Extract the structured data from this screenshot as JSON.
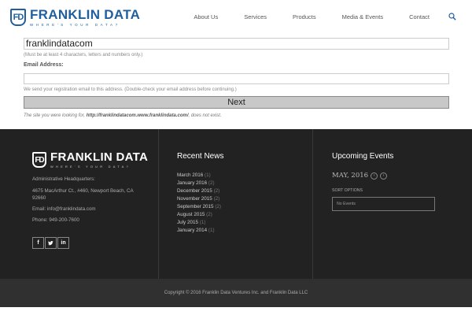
{
  "brand": {
    "mark": "FD",
    "name": "FRANKLIN DATA",
    "tagline": "WHERE'S YOUR DATA?"
  },
  "nav": {
    "items": [
      "About Us",
      "Services",
      "Products",
      "Media & Events",
      "Contact"
    ],
    "search_icon": "search-icon"
  },
  "form": {
    "username_value": "franklindatacom",
    "username_hint": "(Must be at least 4 characters, letters and numbers only.)",
    "email_label": "Email Address:",
    "email_value": "",
    "email_hint": "We send your registration email to this address. (Double-check your email address before continuing.)",
    "next_label": "Next",
    "error_prefix": "The site you were looking for, ",
    "error_site": "http://franklindatacom.www.franklindata.com/",
    "error_suffix": ", does not exist."
  },
  "footer": {
    "about": {
      "headquarters_label": "Administrative Headquarters:",
      "address_line1": "4675 MacArthur Ct., #460, Newport Beach, CA",
      "address_line2": "92660",
      "email": "Email: info@franklindata.com",
      "phone": "Phone: 949-200-7600",
      "social": [
        "f",
        "t",
        "in"
      ]
    },
    "news": {
      "heading": "Recent News",
      "items": [
        {
          "label": "March 2016",
          "count": "(1)"
        },
        {
          "label": "January 2016",
          "count": "(2)"
        },
        {
          "label": "December 2015",
          "count": "(2)"
        },
        {
          "label": "November 2015",
          "count": "(2)"
        },
        {
          "label": "September 2015",
          "count": "(2)"
        },
        {
          "label": "August 2015",
          "count": "(2)"
        },
        {
          "label": "July 2015",
          "count": "(1)"
        },
        {
          "label": "January 2014",
          "count": "(1)"
        }
      ]
    },
    "events": {
      "heading": "Upcoming Events",
      "month": "MAY, 2016",
      "prev": "‹",
      "next": "›",
      "sort_label": "SORT OPTIONS",
      "empty_text": "No Events"
    },
    "copyright": "Copyright © 2016 Franklin Data Ventures Inc. and Franklin Data LLC"
  },
  "colors": {
    "brand_blue": "#1f5f9f",
    "footer_bg": "#222222",
    "subfooter_bg": "#303030",
    "button_bg": "#c8c8c8"
  }
}
